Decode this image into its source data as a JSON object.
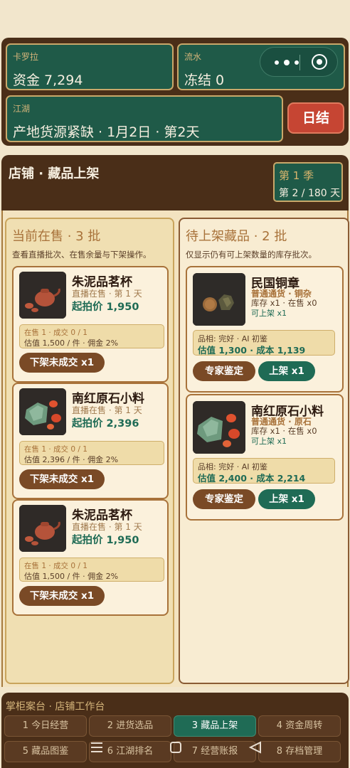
{
  "status": {
    "player_name": "卡罗拉",
    "funds": "资金 7,294",
    "flow_label": "流水",
    "flow_value": "冻结 0",
    "jianghu_label": "江湖",
    "jianghu_value": "产地货源紧缺 · 1月2日 · 第2天",
    "daily_button": "日结"
  },
  "header": {
    "title": "店铺 · 藏品上架",
    "season": "第 1 季",
    "day": "第 2 / 180 天"
  },
  "on_sale": {
    "title": "当前在售 · 3 批",
    "desc": "查看直播批次、在售余量与下架操作。",
    "items": [
      {
        "name": "朱泥品茗杯",
        "sub": "直播在售 · 第 1 天",
        "price": "起拍价 1,950",
        "stat1": "在售 1 · 成交 0 / 1",
        "stat2": "估值 1,500 / 件 · 佣金 2%",
        "button": "下架未成交 x1",
        "image": "teapot"
      },
      {
        "name": "南红原石小料",
        "sub": "直播在售 · 第 1 天",
        "price": "起拍价 2,396",
        "stat1": "在售 1 · 成交 0 / 1",
        "stat2": "估值 2,396 / 件 · 佣金 2%",
        "button": "下架未成交 x1",
        "image": "stones"
      },
      {
        "name": "朱泥品茗杯",
        "sub": "直播在售 · 第 1 天",
        "price": "起拍价 1,950",
        "stat1": "在售 1 · 成交 0 / 1",
        "stat2": "估值 1,500 / 件 · 佣金 2%",
        "button": "下架未成交 x1",
        "image": "teapot"
      }
    ]
  },
  "pending": {
    "title": "待上架藏品 · 2 批",
    "desc": "仅显示仍有可上架数量的库存批次。",
    "items": [
      {
        "name": "民国铜章",
        "category": "普通通货 · 铜杂",
        "stock": "库存 x1 · 在售 x0",
        "available": "可上架 x1",
        "stat1": "品相: 完好 · AI 初鉴",
        "stat2": "估值 1,300 · 成本 1,139",
        "appraise_button": "专家鉴定",
        "list_button": "上架 x1",
        "image": "coin"
      },
      {
        "name": "南红原石小料",
        "category": "普通通货 · 原石",
        "stock": "库存 x1 · 在售 x0",
        "available": "可上架 x1",
        "stat1": "品相: 完好 · AI 初鉴",
        "stat2": "估值 2,400 · 成本 2,214",
        "appraise_button": "专家鉴定",
        "list_button": "上架 x1",
        "image": "stones"
      }
    ]
  },
  "dock": {
    "title": "掌柜案台 · 店铺工作台",
    "tabs": [
      {
        "label": "1 今日经营",
        "active": false
      },
      {
        "label": "2 进货选品",
        "active": false
      },
      {
        "label": "3 藏品上架",
        "active": true
      },
      {
        "label": "4 资金周转",
        "active": false
      },
      {
        "label": "5 藏品图鉴",
        "active": false
      },
      {
        "label": "6 江湖排名",
        "active": false
      },
      {
        "label": "7 经营账报",
        "active": false
      },
      {
        "label": "8 存档管理",
        "active": false
      }
    ]
  },
  "colors": {
    "panel_brown": "#4a2e18",
    "card_green": "#1f5a48",
    "accent_gold": "#c9a86a",
    "price_green": "#1f6b55",
    "danger_red": "#c64533",
    "background": "#f2e6cc"
  },
  "icons": [
    "more-dots-icon",
    "capsule-target-icon",
    "menu-lines-icon",
    "home-square-icon",
    "back-triangle-icon"
  ]
}
